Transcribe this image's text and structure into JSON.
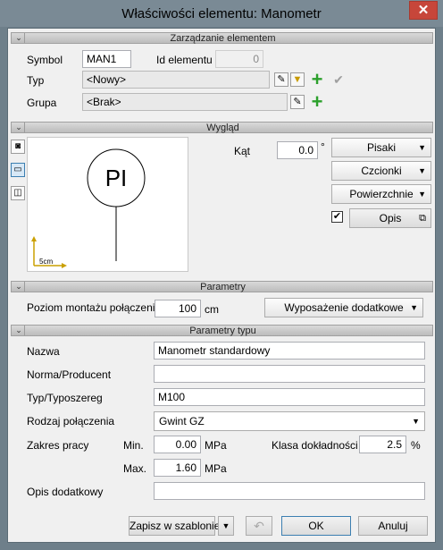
{
  "window": {
    "title": "Właściwości elementu: Manometr",
    "close_glyph": "✕"
  },
  "sections": {
    "management": "Zarządzanie elementem",
    "appearance": "Wygląd",
    "parameters": "Parametry",
    "type_parameters": "Parametry typu"
  },
  "management": {
    "symbol_label": "Symbol",
    "symbol_value": "MAN1",
    "id_label": "Id elementu",
    "id_value": "0",
    "type_label": "Typ",
    "type_value": "<Nowy>",
    "group_label": "Grupa",
    "group_value": "<Brak>"
  },
  "appearance": {
    "angle_label": "Kąt",
    "angle_value": "0.0",
    "angle_unit": "°",
    "pens_label": "Pisaki",
    "fonts_label": "Czcionki",
    "surfaces_label": "Powierzchnie",
    "description_label": "Opis",
    "description_checked": true,
    "preview_symbol": "PI",
    "scale_label": "5cm"
  },
  "parameters": {
    "mount_label": "Poziom montażu połączenia",
    "mount_value": "100",
    "mount_unit": "cm",
    "equipment_label": "Wyposażenie dodatkowe"
  },
  "type_parameters": {
    "name_label": "Nazwa",
    "name_value": "Manometr standardowy",
    "norm_label": "Norma/Producent",
    "norm_value": "",
    "series_label": "Typ/Typoszereg",
    "series_value": "M100",
    "connection_label": "Rodzaj połączenia",
    "connection_value": "Gwint GZ",
    "range_label": "Zakres pracy",
    "min_label": "Min.",
    "min_value": "0.00",
    "max_label": "Max.",
    "max_value": "1.60",
    "range_unit": "MPa",
    "accuracy_label": "Klasa dokładności",
    "accuracy_value": "2.5",
    "accuracy_unit": "%",
    "extra_label": "Opis dodatkowy",
    "extra_value": ""
  },
  "footer": {
    "save_template_label": "Zapisz w szablonie",
    "ok_label": "OK",
    "cancel_label": "Anuluj"
  },
  "colors": {
    "plus_green": "#2ca02c",
    "title_bg": "#7a8a95",
    "close_red": "#c7463a"
  }
}
